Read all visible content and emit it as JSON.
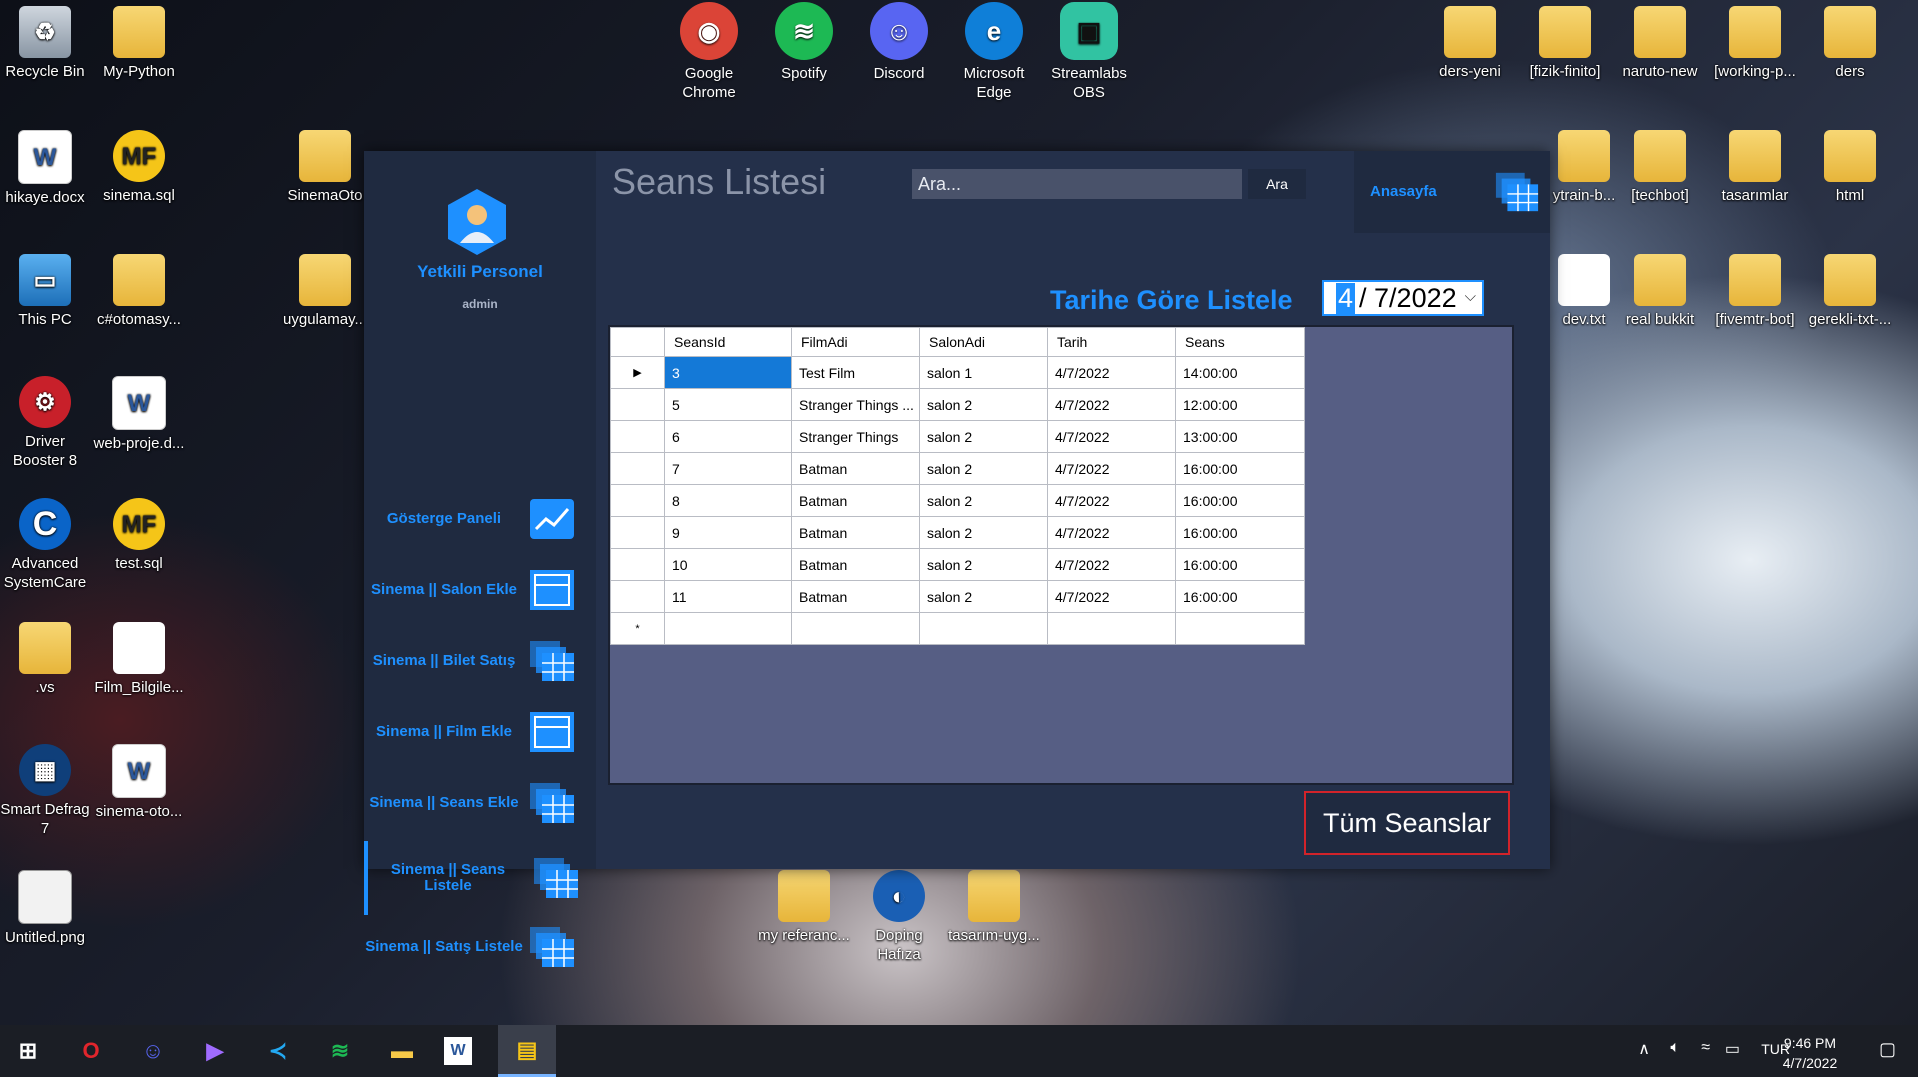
{
  "desktop": {
    "left_icons": [
      {
        "label": "Recycle Bin",
        "icon": "recycle-bin-icon"
      },
      {
        "label": "My-Python",
        "icon": "folder-icon"
      },
      {
        "label": "hikaye.docx",
        "icon": "word-document-icon"
      },
      {
        "label": "sinema.sql",
        "icon": "mf-icon"
      },
      {
        "label": "SinemaOto",
        "icon": "folder-icon"
      },
      {
        "label": "This PC",
        "icon": "computer-icon"
      },
      {
        "label": "c#otomasy...",
        "icon": "folder-icon"
      },
      {
        "label": "uygulamay...",
        "icon": "folder-icon"
      },
      {
        "label": "Driver Booster 8",
        "icon": "driver-booster-icon"
      },
      {
        "label": "web-proje.d...",
        "icon": "word-document-icon"
      },
      {
        "label": "Advanced SystemCare",
        "icon": "advanced-systemcare-icon"
      },
      {
        "label": "test.sql",
        "icon": "mf-icon"
      },
      {
        "label": ".vs",
        "icon": "folder-icon"
      },
      {
        "label": "Film_Bilgile...",
        "icon": "blank-file-icon"
      },
      {
        "label": "Smart Defrag 7",
        "icon": "smart-defrag-icon"
      },
      {
        "label": "sinema-oto...",
        "icon": "word-document-icon"
      },
      {
        "label": "Untitled.png",
        "icon": "image-file-icon"
      }
    ],
    "top_apps": [
      {
        "label": "Google Chrome",
        "icon": "chrome-icon",
        "color": "#db4437"
      },
      {
        "label": "Spotify",
        "icon": "spotify-icon",
        "color": "#1db954"
      },
      {
        "label": "Discord",
        "icon": "discord-icon",
        "color": "#5865f2"
      },
      {
        "label": "Microsoft Edge",
        "icon": "edge-icon",
        "color": "#0f7fd8"
      },
      {
        "label": "Streamlabs OBS",
        "icon": "streamlabs-icon",
        "color": "#31c3a2"
      }
    ],
    "right_icons": [
      {
        "label": "ders-yeni"
      },
      {
        "label": "[fizik-finito]"
      },
      {
        "label": "naruto-new"
      },
      {
        "label": "[working-p..."
      },
      {
        "label": "ders"
      },
      {
        "label": "ytrain-b..."
      },
      {
        "label": "[techbot]"
      },
      {
        "label": "tasarımlar"
      },
      {
        "label": "html"
      },
      {
        "label": "dev.txt"
      },
      {
        "label": "real bukkit"
      },
      {
        "label": "[fivemtr-bot]"
      },
      {
        "label": "gerekli-txt-..."
      }
    ],
    "bottom_icons": [
      {
        "label": "my referanc..."
      },
      {
        "label": "Doping Hafıza"
      },
      {
        "label": "tasarım-uyg..."
      }
    ]
  },
  "app": {
    "title": "Seans Listesi",
    "search": {
      "placeholder": "Ara...",
      "button": "Ara"
    },
    "home_label": "Anasayfa",
    "user": {
      "title": "Yetkili Personel",
      "role": "admin"
    },
    "nav": [
      {
        "label": "Gösterge Paneli"
      },
      {
        "label": "Sinema || Salon Ekle"
      },
      {
        "label": "Sinema || Bilet Satış"
      },
      {
        "label": "Sinema || Film Ekle"
      },
      {
        "label": "Sinema || Seans Ekle"
      },
      {
        "label": "Sinema || Seans Listele"
      },
      {
        "label": "Sinema || Satış Listele"
      }
    ],
    "filter_label": "Tarihe Göre Listele",
    "date": {
      "day": "4",
      "rest": "/  7/2022"
    },
    "table": {
      "columns": [
        "SeansId",
        "FilmAdi",
        "SalonAdi",
        "Tarih",
        "Seans"
      ],
      "rows": [
        [
          "3",
          "Test Film",
          "salon 1",
          "4/7/2022",
          "14:00:00"
        ],
        [
          "5",
          "Stranger Things ...",
          "salon 2",
          "4/7/2022",
          "12:00:00"
        ],
        [
          "6",
          "Stranger Things",
          "salon 2",
          "4/7/2022",
          "13:00:00"
        ],
        [
          "7",
          "Batman",
          "salon 2",
          "4/7/2022",
          "16:00:00"
        ],
        [
          "8",
          "Batman",
          "salon 2",
          "4/7/2022",
          "16:00:00"
        ],
        [
          "9",
          "Batman",
          "salon 2",
          "4/7/2022",
          "16:00:00"
        ],
        [
          "10",
          "Batman",
          "salon 2",
          "4/7/2022",
          "16:00:00"
        ],
        [
          "11",
          "Batman",
          "salon 2",
          "4/7/2022",
          "16:00:00"
        ]
      ],
      "current_row_marker": "▶",
      "new_row_marker": "*"
    },
    "all_button": "Tüm Seanslar"
  },
  "taskbar": {
    "apps": [
      "start-icon",
      "opera-icon",
      "discord-icon",
      "visual-studio-icon",
      "vscode-icon",
      "spotify-icon",
      "file-explorer-icon",
      "word-icon",
      "winforms-app-icon"
    ],
    "language": "TUR",
    "time": "9:46 PM",
    "date": "4/7/2022"
  }
}
